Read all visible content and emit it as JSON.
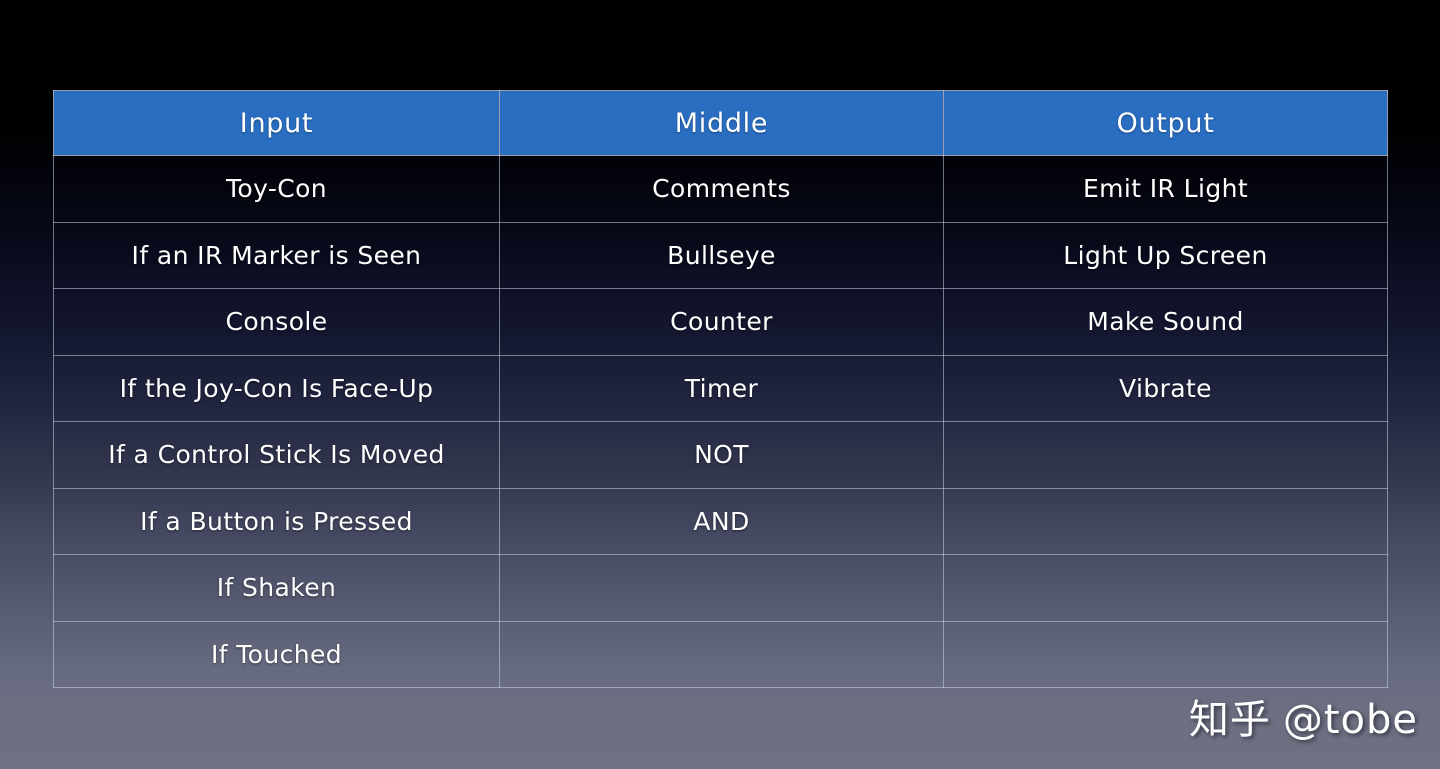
{
  "background": {
    "top_color": "#000000",
    "bottom_color": "#6e7082"
  },
  "table": {
    "header_color": "#2a6ec2",
    "text_color": "#ffffff",
    "border_color": "#c8d2e1",
    "columns": [
      "Input",
      "Middle",
      "Output"
    ],
    "rows": [
      [
        "Toy-Con",
        "Comments",
        "Emit IR Light"
      ],
      [
        "If an IR Marker is Seen",
        "Bullseye",
        "Light Up Screen"
      ],
      [
        "Console",
        "Counter",
        "Make Sound"
      ],
      [
        "If the Joy-Con Is Face-Up",
        "Timer",
        "Vibrate"
      ],
      [
        "If a Control Stick Is Moved",
        "NOT",
        ""
      ],
      [
        "If a Button is Pressed",
        "AND",
        ""
      ],
      [
        "If Shaken",
        "",
        ""
      ],
      [
        "If Touched",
        "",
        ""
      ]
    ]
  },
  "watermark": {
    "site": "知乎",
    "handle": "@tobe"
  }
}
